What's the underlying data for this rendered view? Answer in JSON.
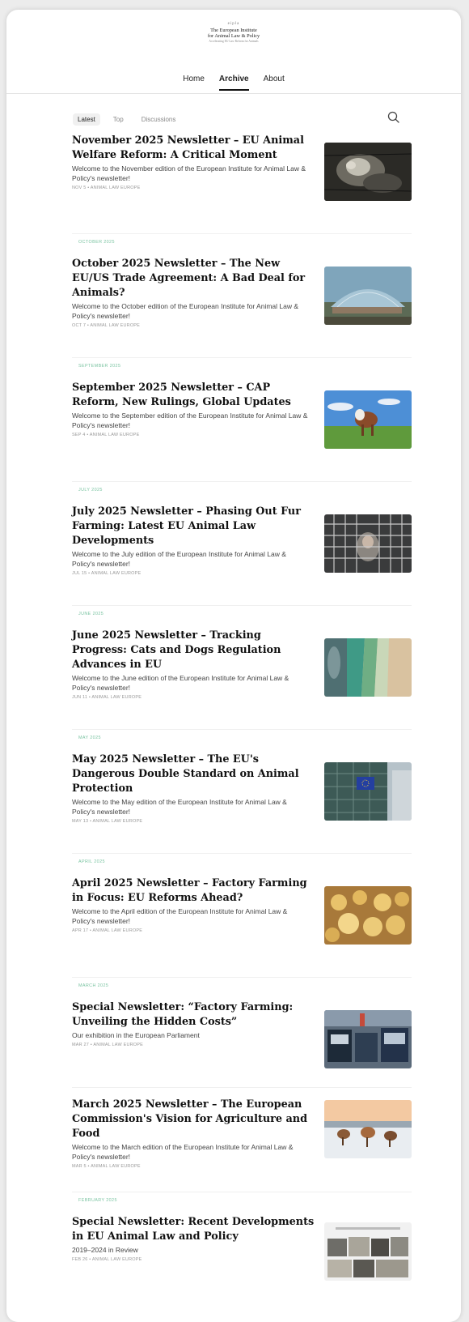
{
  "publication": {
    "mark": "eipla",
    "name_line1": "The European Institute",
    "name_line2": "for Animal Law & Policy",
    "tagline": "Accelerating EU Law Reform for Animals"
  },
  "nav": {
    "items": [
      "Home",
      "Archive",
      "About"
    ],
    "active": "Archive"
  },
  "filters": {
    "tabs": [
      "Latest",
      "Top",
      "Discussions"
    ],
    "active": "Latest"
  },
  "search_icon": "search-icon",
  "colors": {
    "accent_month": "#7bc4a2",
    "text": "#111111",
    "meta": "#999999"
  },
  "posts": [
    {
      "month": "",
      "title": "November 2025 Newsletter – EU Animal Welfare Reform: A Critical Moment",
      "subtitle": "Welcome to the November edition of the European Institute for Animal Law & Policy's newsletter!",
      "meta": "NOV 5 • ANIMAL LAW EUROPE",
      "thumb": "pig-in-cage"
    },
    {
      "month": "OCTOBER 2025",
      "title": "October 2025 Newsletter – The New EU/US Trade Agreement: A Bad Deal for Animals?",
      "subtitle": "Welcome to the October edition of the European Institute for Animal Law & Policy's newsletter!",
      "meta": "OCT 7 • ANIMAL LAW EUROPE",
      "thumb": "greenhouse-tunnel"
    },
    {
      "month": "SEPTEMBER 2025",
      "title": "September 2025 Newsletter – CAP Reform, New Rulings, Global Updates",
      "subtitle": "Welcome to the September edition of the European Institute for Animal Law & Policy's newsletter!",
      "meta": "SEP 4 • ANIMAL LAW EUROPE",
      "thumb": "cow-in-field"
    },
    {
      "month": "JULY 2025",
      "title": "July 2025 Newsletter – Phasing Out Fur Farming: Latest EU Animal Law Developments",
      "subtitle": "Welcome to the July edition of the European Institute for Animal Law & Policy's newsletter!",
      "meta": "JUL 15 • ANIMAL LAW EUROPE",
      "thumb": "animal-behind-wire"
    },
    {
      "month": "JUNE 2025",
      "title": "June 2025 Newsletter – Tracking Progress: Cats and Dogs Regulation Advances in EU",
      "subtitle": "Welcome to the June edition of the European Institute for Animal Law & Policy's newsletter!",
      "meta": "JUN 11 • ANIMAL LAW EUROPE",
      "thumb": "aerial-coastline"
    },
    {
      "month": "MAY 2025",
      "title": "May 2025 Newsletter – The EU's Dangerous Double Standard on Animal Protection",
      "subtitle": "Welcome to the May edition of the European Institute for Animal Law & Policy's newsletter!",
      "meta": "MAY 13 • ANIMAL LAW EUROPE",
      "thumb": "eu-parliament-building"
    },
    {
      "month": "APRIL 2025",
      "title": "April 2025 Newsletter – Factory Farming in Focus: EU Reforms Ahead?",
      "subtitle": "Welcome to the April edition of the European Institute for Animal Law & Policy's newsletter!",
      "meta": "APR 17 • ANIMAL LAW EUROPE",
      "thumb": "chicks"
    },
    {
      "month": "MARCH 2025",
      "title": "Special Newsletter: “Factory Farming: Unveiling the Hidden Costs”",
      "subtitle": "Our exhibition in the European Parliament",
      "meta": "MAR 27 • ANIMAL LAW EUROPE",
      "thumb": "exhibition-hall"
    },
    {
      "month": "",
      "title": "March 2025 Newsletter – The European Commission's Vision for Agriculture and Food",
      "subtitle": "Welcome to the March edition of the European Institute for Animal Law & Policy's newsletter!",
      "meta": "MAR 5 • ANIMAL LAW EUROPE",
      "thumb": "cattle-in-snow"
    },
    {
      "month": "FEBRUARY 2025",
      "title": "Special Newsletter: Recent Developments in EU Animal Law and Policy",
      "subtitle": "2019–2024 in Review",
      "meta": "FEB 26 • ANIMAL LAW EUROPE",
      "thumb": "review-collage"
    }
  ]
}
